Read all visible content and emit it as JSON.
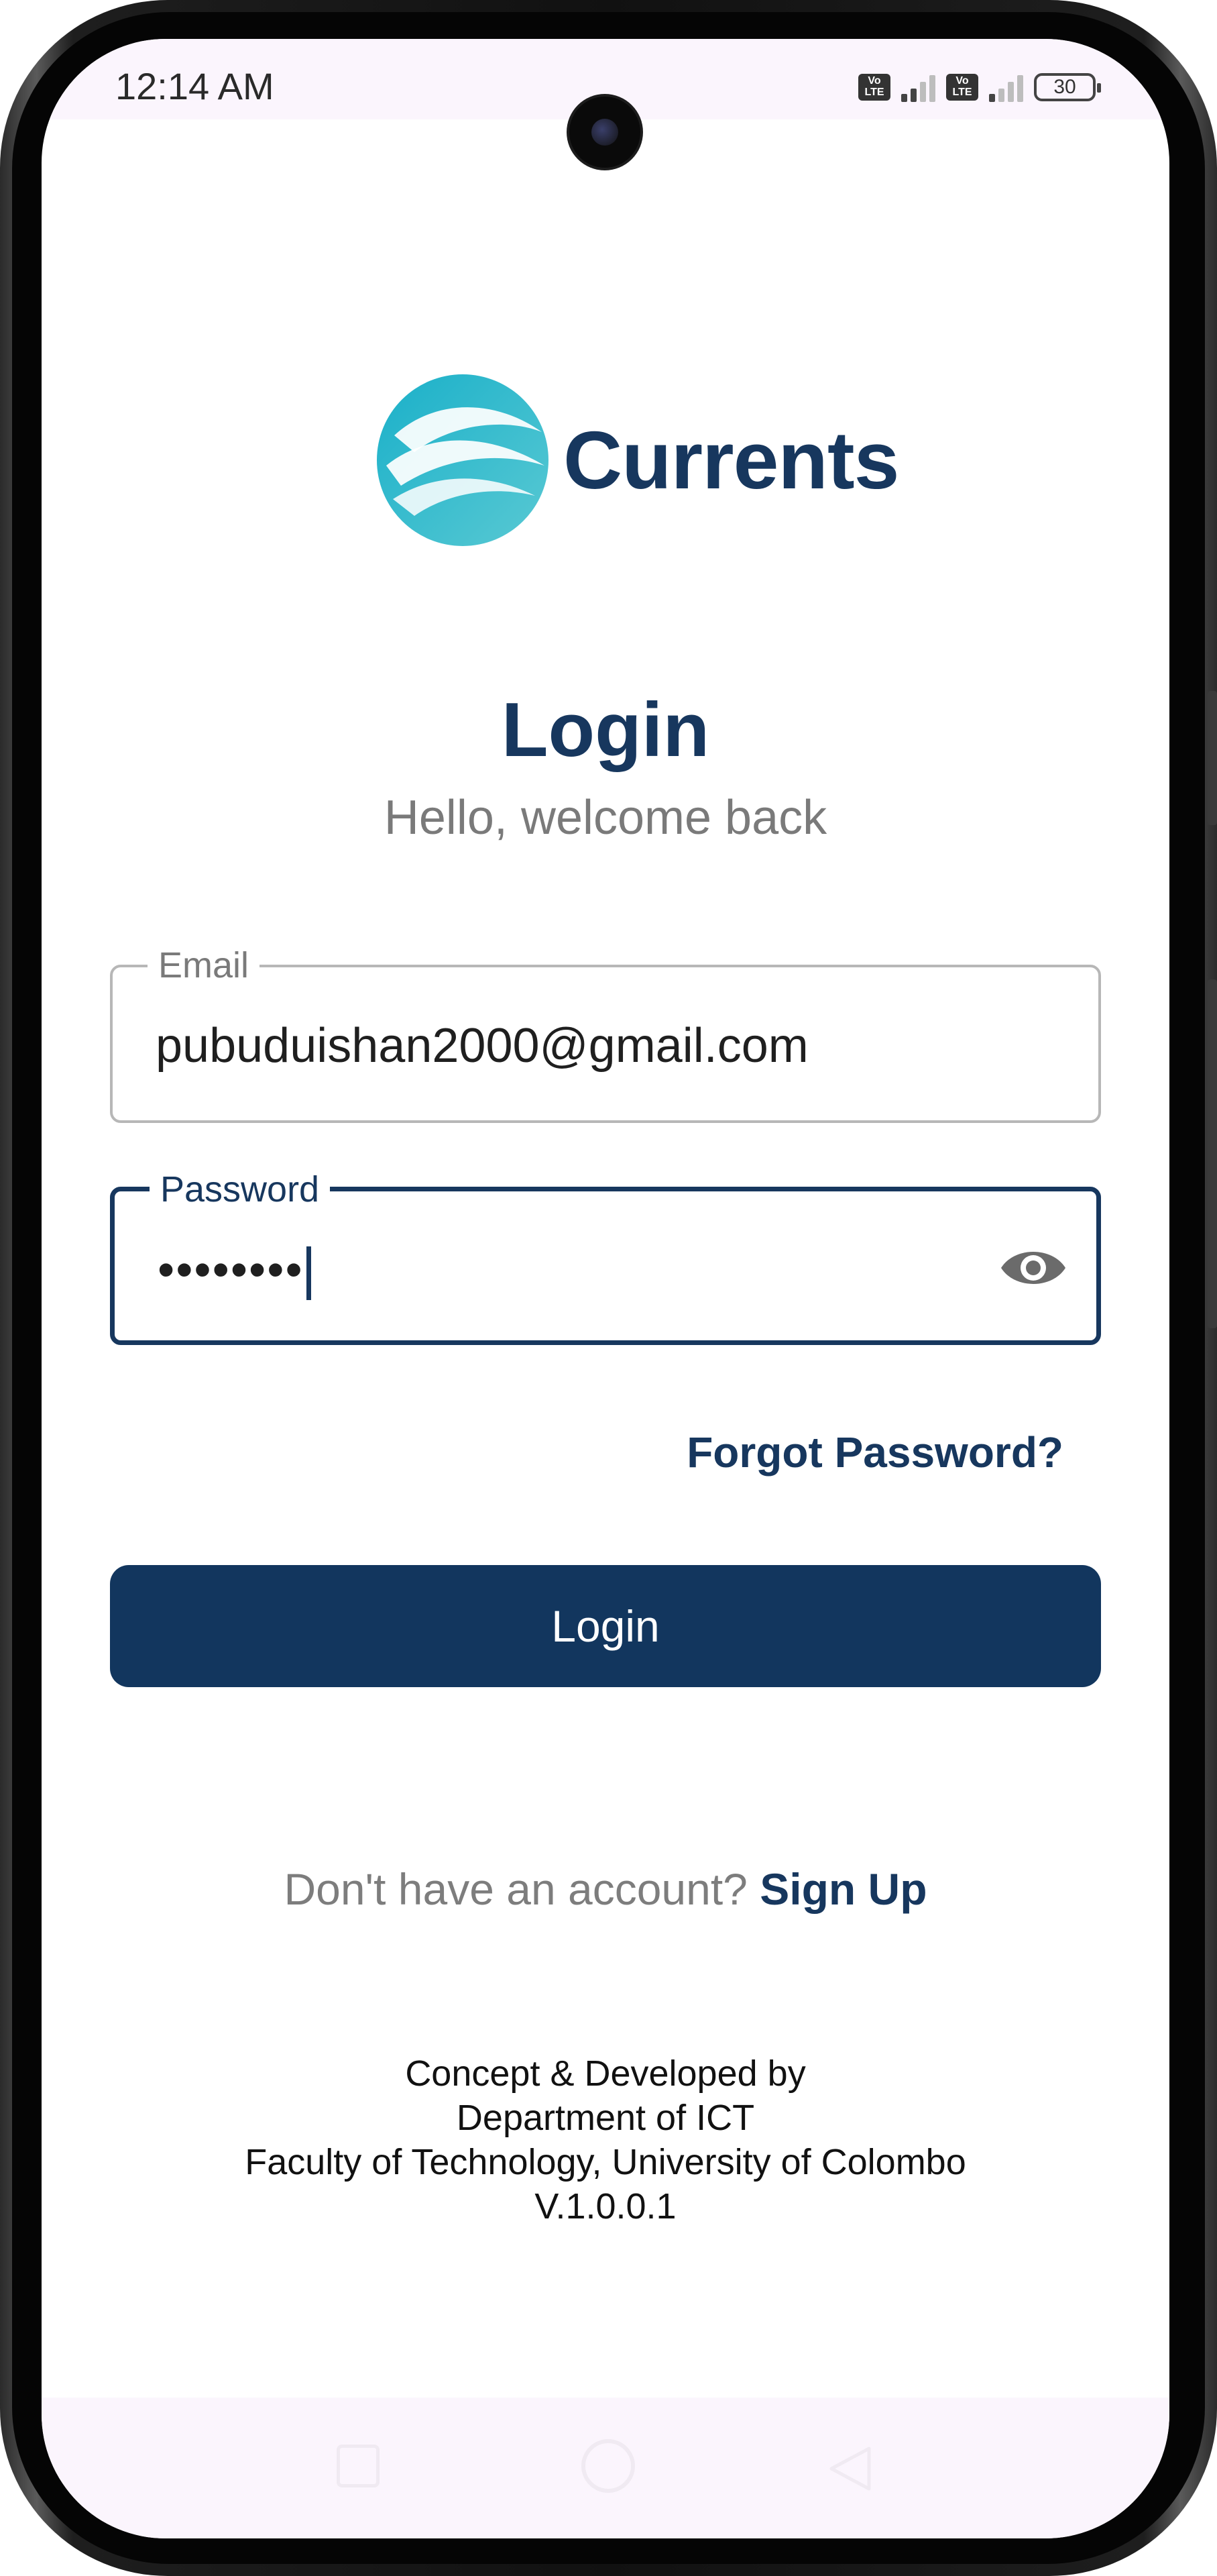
{
  "status_bar": {
    "time": "12:14 AM",
    "volte_label_1": "Vo LTE",
    "volte_label_2": "Vo LTE",
    "battery": "30"
  },
  "app": {
    "name": "Currents",
    "brand_color": "#17375e",
    "accent_color": "#2bb4c8"
  },
  "login": {
    "title": "Login",
    "subtitle": "Hello, welcome back",
    "email_label": "Email",
    "email_value": "pubuduishan2000@gmail.com",
    "password_label": "Password",
    "password_value": "••••••••",
    "password_toggle_icon": "eye-icon",
    "forgot_label": "Forgot Password?",
    "login_button": "Login",
    "signup_prompt": "Don't have an account?",
    "signup_link": "Sign Up"
  },
  "credits": {
    "line1": "Concept & Developed by",
    "line2": "Department of ICT",
    "line3": "Faculty of Technology, University of Colombo",
    "version": "V.1.0.0.1"
  },
  "nav_icons": [
    "recent-apps-icon",
    "home-icon",
    "back-icon"
  ]
}
